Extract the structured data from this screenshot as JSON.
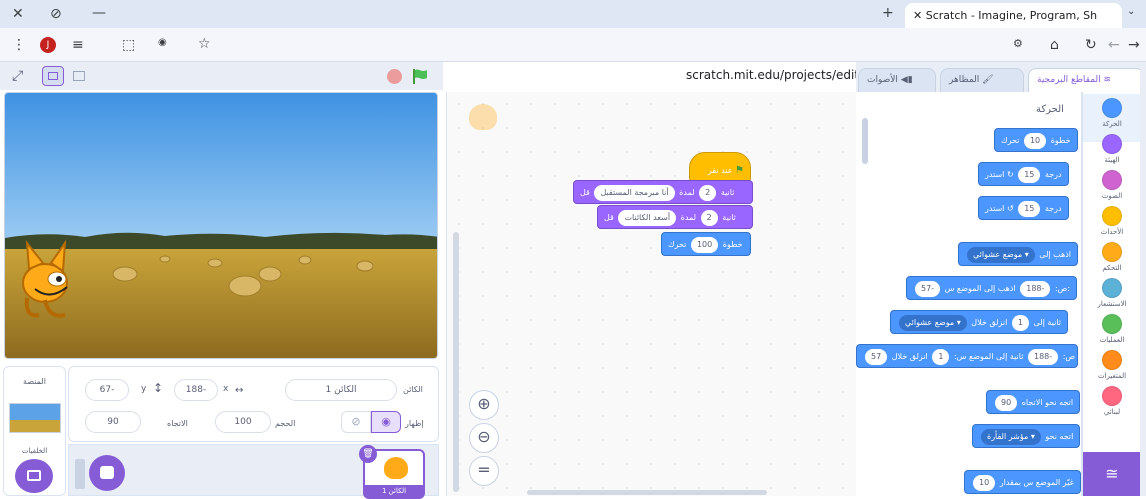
{
  "browser": {
    "tab_title": "Scratch - Imagine, Program, Sh",
    "url": "scratch.mit.edu/projects/editor/?tutorial=getStarted",
    "profile_initial": "J"
  },
  "stage": {
    "sprite_name_label": "الكائن",
    "sprite_name_value": "الكائن 1",
    "x_label": "x",
    "x_value": "188-",
    "y_label": "y",
    "y_value": "67-",
    "show_label": "إظهار",
    "size_label": "الحجم",
    "size_value": "100",
    "direction_label": "الاتجاه",
    "direction_value": "90",
    "stage_panel_label": "المنصة",
    "backdrops_label": "الخلفيات",
    "sprite_thumb_label": "الكائن 1"
  },
  "editor_tabs": {
    "code": "المقاطع البرمجية",
    "costumes": "المظاهر",
    "sounds": "الأصوات"
  },
  "palette": {
    "section_title": "الحركة",
    "blocks": [
      {
        "text": "تحرك",
        "input": "10",
        "suffix": "خطوة"
      },
      {
        "text": "استدر",
        "input": "15",
        "suffix": "درجة"
      },
      {
        "text": "استدر",
        "input": "15",
        "suffix": "درجة"
      },
      {
        "text": "اذهب إلى",
        "input": "موضع عشوائي ▾"
      },
      {
        "text": "اذهب إلى الموضع س:",
        "input": "188-",
        "mid": "ص:",
        "input2": "57-"
      },
      {
        "text": "انزلق خلال",
        "input": "1",
        "mid": "ثانية إلى",
        "input2": "موضع عشوائي ▾"
      },
      {
        "text": "انزلق خلال",
        "input": "1",
        "mid": "ثانية إلى الموضع س:",
        "input2": "188-",
        "mid2": "ص:",
        "input3": "57"
      },
      {
        "text": "اتجه نحو الاتجاه",
        "input": "90"
      },
      {
        "text": "اتجه نحو",
        "input": "مؤشر الفأرة ▾"
      },
      {
        "text": "غيّر الموضع س بمقدار",
        "input": "10"
      }
    ]
  },
  "categories": [
    {
      "label": "الحركة",
      "color": "#4c97ff"
    },
    {
      "label": "الهيئة",
      "color": "#9966ff"
    },
    {
      "label": "الصوت",
      "color": "#cf63cf"
    },
    {
      "label": "الأحداث",
      "color": "#ffbf00"
    },
    {
      "label": "التحكم",
      "color": "#ffab19"
    },
    {
      "label": "الاستشعار",
      "color": "#5cb1d6"
    },
    {
      "label": "العمليات",
      "color": "#59c059"
    },
    {
      "label": "المتغيرات",
      "color": "#ff8c1a"
    },
    {
      "label": "لبنائي",
      "color": "#ff6680"
    }
  ],
  "script": {
    "hat": "عند نقر",
    "say_for_1": {
      "prefix": "قل",
      "text": "أنا مبرمجة المستقبل",
      "mid": "لمدة",
      "secs": "2",
      "suffix": "ثانية"
    },
    "say_for_2": {
      "prefix": "قل",
      "text": "أسعد الكائنات",
      "mid": "لمدة",
      "secs": "2",
      "suffix": "ثانية"
    },
    "move": {
      "prefix": "تحرك",
      "input": "100",
      "suffix": "خطوة"
    }
  }
}
